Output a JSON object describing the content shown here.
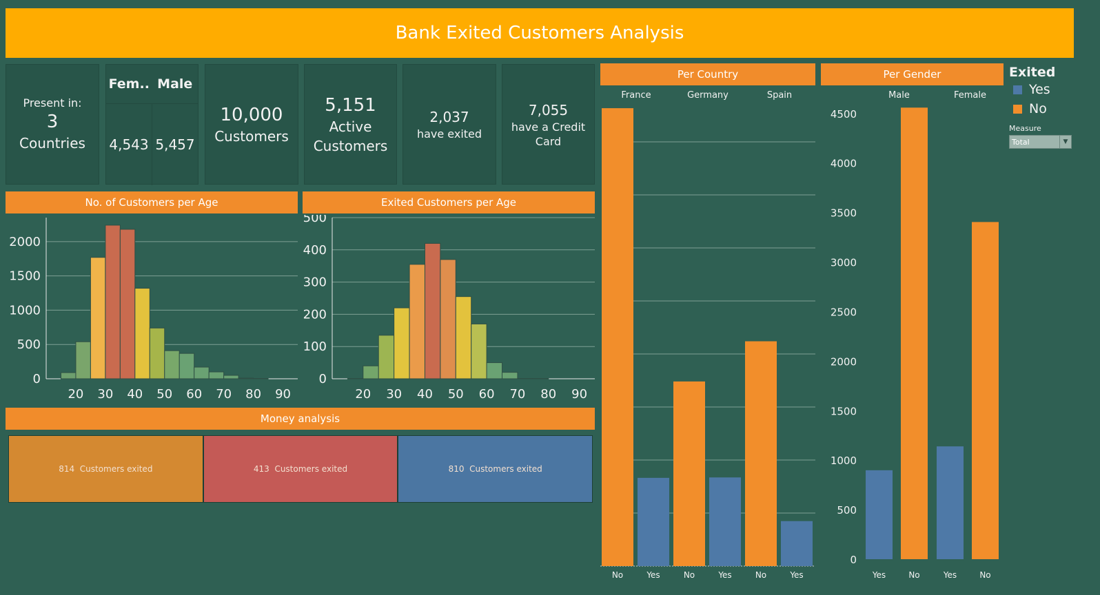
{
  "title": "Bank Exited Customers Analysis",
  "kpis": {
    "present_label": "Present in:",
    "countries_value": "3",
    "countries_label": "Countries",
    "gender_female_label": "Fem..",
    "gender_male_label": "Male",
    "female_count": "4,543",
    "male_count": "5,457",
    "customers_value": "10,000",
    "customers_label": "Customers",
    "active_value": "5,151",
    "active_label_1": "Active",
    "active_label_2": "Customers",
    "exited_value": "2,037",
    "exited_label": "have exited",
    "credit_value": "7,055",
    "credit_label_1": "have a Credit",
    "credit_label_2": "Card"
  },
  "headers": {
    "age_all": "No. of Customers per Age",
    "age_exited": "Exited Customers per Age",
    "money": "Money analysis",
    "country": "Per Country",
    "gender": "Per Gender"
  },
  "money": [
    {
      "value": "814",
      "label": "Customers exited",
      "color": "#d48931"
    },
    {
      "value": "413",
      "label": "Customers exited",
      "color": "#c45a56"
    },
    {
      "value": "810",
      "label": "Customers exited",
      "color": "#4b76a2"
    }
  ],
  "legend": {
    "title": "Exited",
    "items": [
      {
        "label": "Yes",
        "color": "#4e79a7"
      },
      {
        "label": "No",
        "color": "#f28e2b"
      }
    ],
    "measure_label": "Measure",
    "measure_value": "Total"
  },
  "chart_data": [
    {
      "type": "bar",
      "title": "No. of Customers per Age",
      "categories": [
        "15-20",
        "20-25",
        "25-30",
        "30-35",
        "35-40",
        "40-45",
        "45-50",
        "50-55",
        "55-60",
        "60-65",
        "65-70",
        "70-75",
        "75-80",
        "80-85"
      ],
      "values": [
        90,
        540,
        1770,
        2240,
        2180,
        1320,
        740,
        410,
        370,
        170,
        100,
        50,
        10,
        5
      ],
      "colors": [
        "#6d9f6e",
        "#7aa56b",
        "#f0b44a",
        "#c96b4f",
        "#c96b4f",
        "#e3c23d",
        "#a6b54a",
        "#79a86a",
        "#6aa273",
        "#6aa273",
        "#6aa273",
        "#6aa273",
        "#6aa273",
        "#6aa273"
      ],
      "x_ticks": [
        "20",
        "30",
        "40",
        "50",
        "60",
        "70",
        "80",
        "90"
      ],
      "y_ticks": [
        "0",
        "500",
        "1000",
        "1500",
        "2000"
      ],
      "ylim": [
        0,
        2350
      ],
      "xlim": [
        10,
        95
      ]
    },
    {
      "type": "bar",
      "title": "Exited Customers per Age",
      "categories": [
        "15-20",
        "20-25",
        "25-30",
        "30-35",
        "35-40",
        "40-45",
        "45-50",
        "50-55",
        "55-60",
        "60-65",
        "65-70",
        "70-75",
        "75-80"
      ],
      "values": [
        1,
        40,
        135,
        220,
        355,
        420,
        370,
        255,
        170,
        50,
        20,
        1,
        1
      ],
      "colors": [
        "#6aa273",
        "#74a66a",
        "#9db552",
        "#e2c53e",
        "#ea9b4a",
        "#c96b4f",
        "#df8e4d",
        "#e3c23d",
        "#b9bf52",
        "#6aa273",
        "#6aa273",
        "#6aa273",
        "#6aa273"
      ],
      "x_ticks": [
        "20",
        "30",
        "40",
        "50",
        "60",
        "70",
        "80",
        "90"
      ],
      "y_ticks": [
        "0",
        "100",
        "200",
        "300",
        "400",
        "500"
      ],
      "ylim": [
        0,
        500
      ],
      "xlim": [
        10,
        95
      ]
    },
    {
      "type": "bar",
      "title": "Per Country",
      "groups": [
        "France",
        "Germany",
        "Spain"
      ],
      "series": [
        {
          "name": "No",
          "values": [
            4204,
            1695,
            2064
          ]
        },
        {
          "name": "Yes",
          "values": [
            810,
            814,
            413
          ]
        }
      ],
      "bar_labels": [
        "No",
        "Yes",
        "No",
        "Yes",
        "No",
        "Yes"
      ],
      "ylim": [
        0,
        4350
      ]
    },
    {
      "type": "bar",
      "title": "Per Gender",
      "groups": [
        "Male",
        "Female"
      ],
      "bars": [
        {
          "label": "Yes",
          "value": 898,
          "exited": "Yes"
        },
        {
          "label": "No",
          "value": 4559,
          "exited": "No"
        },
        {
          "label": "Yes",
          "value": 1139,
          "exited": "Yes"
        },
        {
          "label": "No",
          "value": 3404,
          "exited": "No"
        }
      ],
      "y_ticks": [
        "0",
        "500",
        "1000",
        "1500",
        "2000",
        "2500",
        "3000",
        "3500",
        "4000",
        "4500"
      ],
      "ylim": [
        0,
        4700
      ]
    }
  ]
}
